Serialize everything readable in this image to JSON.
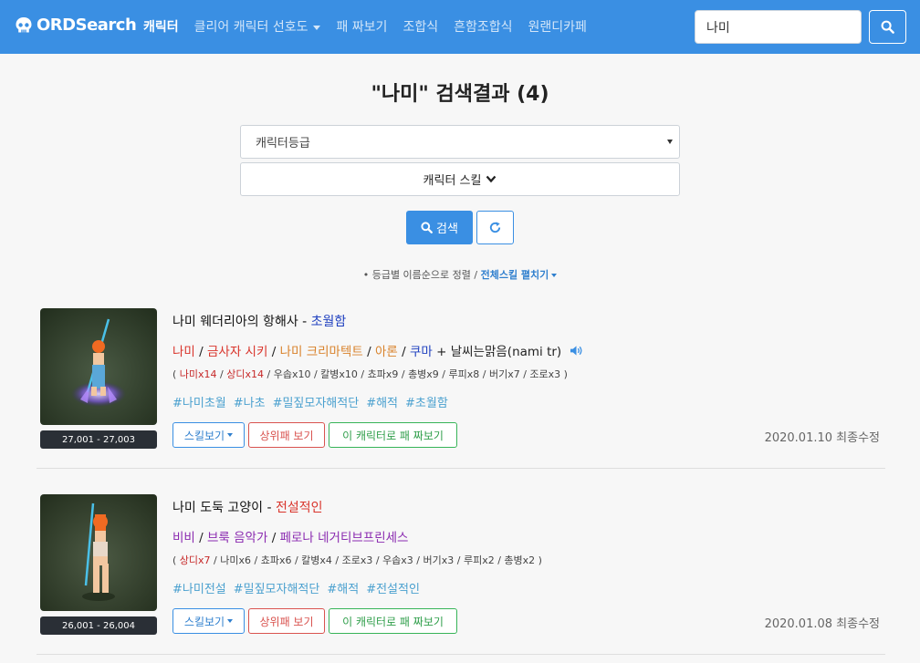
{
  "navbar": {
    "brand": "ORDSearch",
    "items": [
      {
        "label": "캐릭터",
        "active": true
      },
      {
        "label": "클리어 캐릭터 선호도",
        "dropdown": true
      },
      {
        "label": "패 짜보기"
      },
      {
        "label": "조합식"
      },
      {
        "label": "흔함조합식"
      },
      {
        "label": "원랜디카페"
      }
    ],
    "search_value": "나미"
  },
  "page": {
    "title": "\"나미\" 검색결과 (4)",
    "grade_select": "캐릭터등급",
    "skill_toggle": "캐릭터 스킬",
    "search_button": "검색",
    "sort_note": "등급별 이름순으로 정렬 /",
    "expand_all": "전체스킬 펼치기"
  },
  "results": [
    {
      "name": "나미 웨더리아의 항해사",
      "grade": "초월함",
      "grade_color": "#1e3fbf",
      "recipe": [
        {
          "t": "나미",
          "c": "c-red"
        },
        {
          "t": "금사자 시키",
          "c": "c-red"
        },
        {
          "t": "나미 크리마텍트",
          "c": "c-orange"
        },
        {
          "t": "아론",
          "c": "c-orange"
        },
        {
          "t": "쿠마",
          "c": "c-blue"
        }
      ],
      "recipe_extra": "+ 날씨는맑음(nami tr)",
      "counts": [
        {
          "t": "나미x14",
          "c": "c-darkred"
        },
        {
          "t": "상디x14",
          "c": "c-darkred"
        },
        {
          "t": "우솝x10"
        },
        {
          "t": "칼병x10"
        },
        {
          "t": "쵸파x9"
        },
        {
          "t": "총병x9"
        },
        {
          "t": "루피x8"
        },
        {
          "t": "버기x7"
        },
        {
          "t": "조로x3"
        }
      ],
      "tags": [
        "#나미초월",
        "#나초",
        "#밀짚모자해적단",
        "#해적",
        "#초월함"
      ],
      "range": "27,001 - 27,003",
      "date": "2020.01.10 최종수정",
      "btn_skill": "스킬보기",
      "btn_upper": "상위패 보기",
      "btn_deck": "이 캐릭터로 패 짜보기"
    },
    {
      "name": "나미 도둑 고양이",
      "grade": "전설적인",
      "grade_color": "#d9342b",
      "recipe": [
        {
          "t": "비비",
          "c": "c-purple"
        },
        {
          "t": "브룩 음악가",
          "c": "c-purple"
        },
        {
          "t": "페로나 네거티브프린세스",
          "c": "c-purple"
        }
      ],
      "recipe_extra": "",
      "counts": [
        {
          "t": "상디x7",
          "c": "c-darkred"
        },
        {
          "t": "나미x6"
        },
        {
          "t": "쵸파x6"
        },
        {
          "t": "칼병x4"
        },
        {
          "t": "조로x3"
        },
        {
          "t": "우솝x3"
        },
        {
          "t": "버기x3"
        },
        {
          "t": "루피x2"
        },
        {
          "t": "총병x2"
        }
      ],
      "tags": [
        "#나미전설",
        "#밀짚모자해적단",
        "#해적",
        "#전설적인"
      ],
      "range": "26,001 - 26,004",
      "date": "2020.01.08 최종수정",
      "btn_skill": "스킬보기",
      "btn_upper": "상위패 보기",
      "btn_deck": "이 캐릭터로 패 짜보기"
    }
  ],
  "colors": {
    "navbar": "#3a8fe3",
    "accent_blue": "#2f7fce",
    "red": "#d9534f",
    "green": "#37b458"
  },
  "icons": [
    "skull-icon",
    "search-icon",
    "chevron-down-icon",
    "refresh-icon",
    "speaker-icon"
  ]
}
